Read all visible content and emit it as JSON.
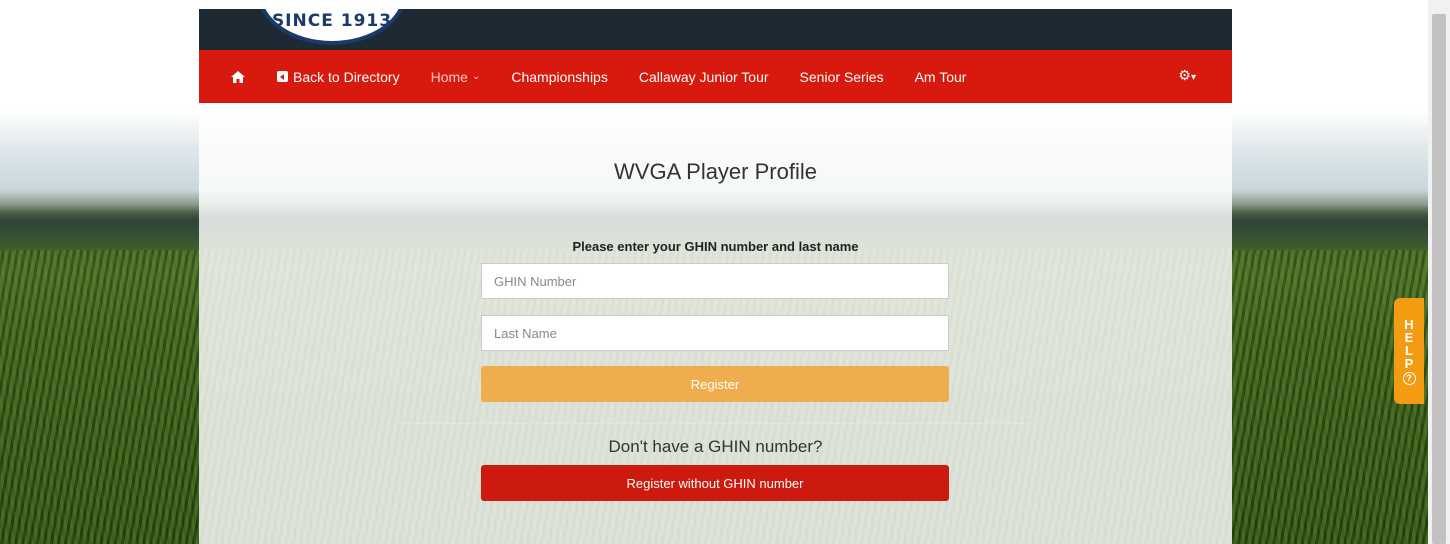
{
  "logo": {
    "text": "SINCE 1913"
  },
  "nav": {
    "home_icon": "home-icon",
    "items": [
      {
        "label": "Back to Directory",
        "icon": "back-square-icon"
      },
      {
        "label": "Home"
      },
      {
        "label": "Championships"
      },
      {
        "label": "Callaway Junior Tour"
      },
      {
        "label": "Senior Series"
      },
      {
        "label": "Am Tour"
      }
    ],
    "settings_icon": "gears-icon"
  },
  "page": {
    "title": "WVGA Player Profile",
    "form_label": "Please enter your GHIN number and last name",
    "ghin_placeholder": "GHIN Number",
    "lastname_placeholder": "Last Name",
    "register_label": "Register",
    "no_ghin_text": "Don't have a GHIN number?",
    "register_no_ghin_label": "Register without GHIN number"
  },
  "help": {
    "letters": [
      "H",
      "E",
      "L",
      "P"
    ],
    "icon": "question-circle-icon"
  },
  "colors": {
    "navbar": "#d7190e",
    "topbar": "#1d2a33",
    "register_button": "#f0ad4e",
    "no_ghin_button": "#cc1a0e",
    "help_tab": "#f39c12"
  }
}
